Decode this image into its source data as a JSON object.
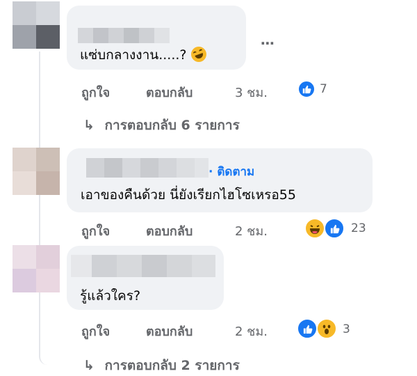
{
  "colors": {
    "like_blue": "#1877f2",
    "haha_yellow": "#f7b928",
    "secondary_text": "#65676b",
    "bubble_bg": "#f0f2f5"
  },
  "comments": [
    {
      "text": "แซ่บกลางงาน.....?",
      "emoji": "rolling-laugh-icon",
      "like_label": "ถูกใจ",
      "reply_label": "ตอบกลับ",
      "time": "3 ชม.",
      "reactions": [
        "like-icon"
      ],
      "reaction_count": "7",
      "more_icon": "⋯",
      "replies_link": "การตอบกลับ 6 รายการ"
    },
    {
      "follow_label": "· ติดตาม",
      "text": "เอาของคืนด้วย นี่ยังเรียกไฮโซเหรอ55",
      "like_label": "ถูกใจ",
      "reply_label": "ตอบกลับ",
      "time": "2 ชม.",
      "reactions": [
        "haha-icon",
        "like-icon"
      ],
      "reaction_count": "23"
    },
    {
      "text": "รู้แล้วใคร?",
      "like_label": "ถูกใจ",
      "reply_label": "ตอบกลับ",
      "time": "2 ชม.",
      "reactions": [
        "like-icon",
        "wow-icon"
      ],
      "reaction_count": "3",
      "replies_link": "การตอบกลับ 2 รายการ"
    }
  ]
}
